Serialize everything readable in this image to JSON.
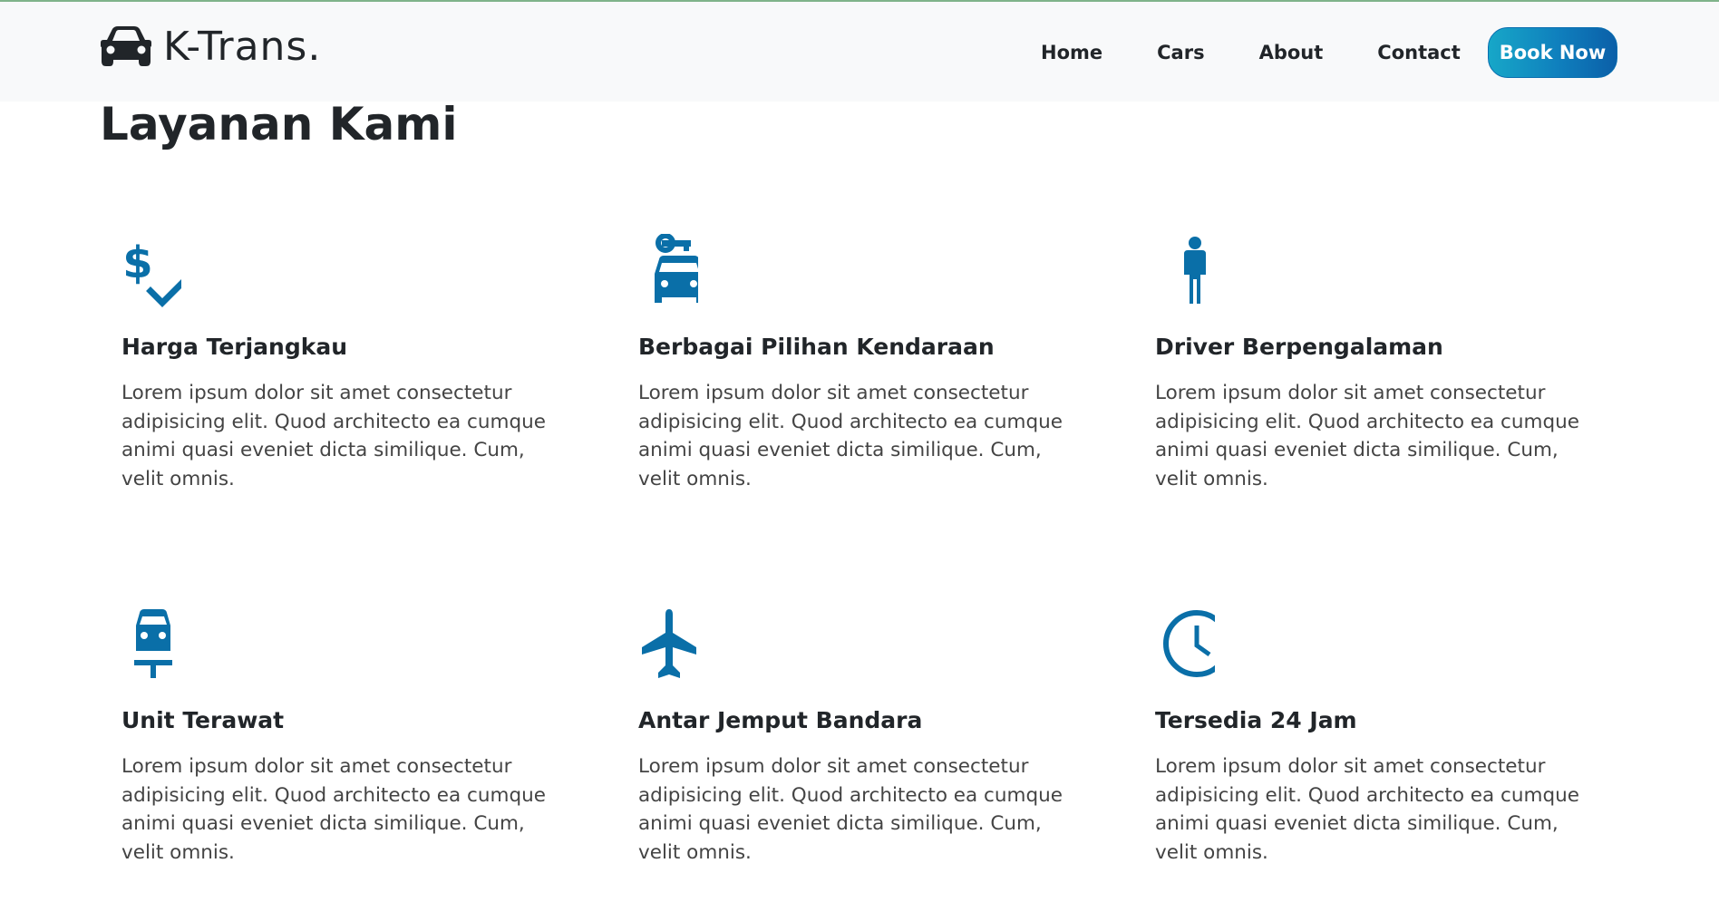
{
  "brand": {
    "name": "K-Trans.",
    "icon": "car-icon"
  },
  "nav": {
    "links": [
      "Home",
      "Cars",
      "About",
      "Contact"
    ],
    "cta": "Book Now"
  },
  "colors": {
    "accent": "#0a6fa8",
    "cta_start": "#17a7c8",
    "cta_end": "#0b5fa8",
    "navbar_bg": "#f8f9fa"
  },
  "section": {
    "title": "Layanan Kami"
  },
  "services": [
    {
      "icon": "price-check-icon",
      "title": "Harga Terjangkau",
      "description": "Lorem ipsum dolor sit amet consectetur adipisicing elit. Quod architecto ea cumque animi quasi eveniet dicta similique. Cum, velit omnis."
    },
    {
      "icon": "car-rental-icon",
      "title": "Berbagai Pilihan Kendaraan",
      "description": "Lorem ipsum dolor sit amet consectetur adipisicing elit. Quod architecto ea cumque animi quasi eveniet dicta similique. Cum, velit omnis."
    },
    {
      "icon": "person-icon",
      "title": "Driver Berpengalaman",
      "description": "Lorem ipsum dolor sit amet consectetur adipisicing elit. Quod architecto ea cumque animi quasi eveniet dicta similique. Cum, velit omnis."
    },
    {
      "icon": "car-repair-icon",
      "title": "Unit Terawat",
      "description": "Lorem ipsum dolor sit amet consectetur adipisicing elit. Quod architecto ea cumque animi quasi eveniet dicta similique. Cum, velit omnis."
    },
    {
      "icon": "airplane-icon",
      "title": "Antar Jemput Bandara",
      "description": "Lorem ipsum dolor sit amet consectetur adipisicing elit. Quod architecto ea cumque animi quasi eveniet dicta similique. Cum, velit omnis."
    },
    {
      "icon": "clock-icon",
      "title": "Tersedia 24 Jam",
      "description": "Lorem ipsum dolor sit amet consectetur adipisicing elit. Quod architecto ea cumque animi quasi eveniet dicta similique. Cum, velit omnis."
    }
  ]
}
